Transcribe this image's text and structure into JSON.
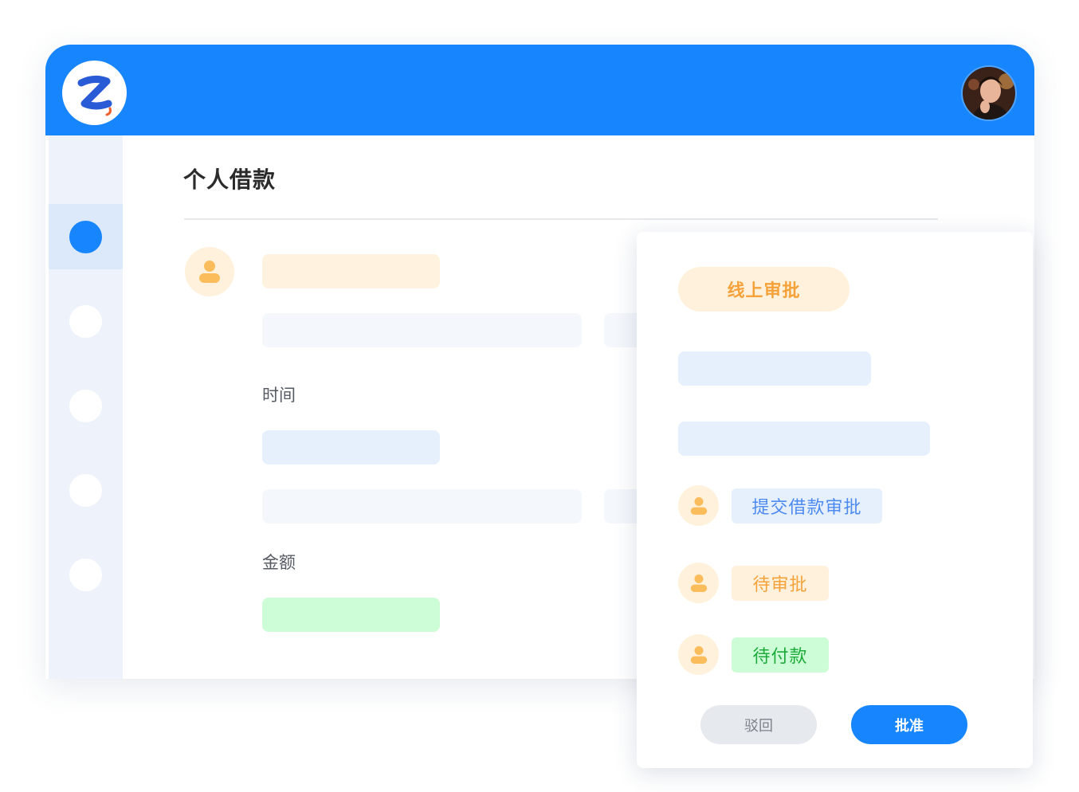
{
  "page": {
    "title": "个人借款"
  },
  "form": {
    "time_label": "时间",
    "amount_label": "金额"
  },
  "approval_card": {
    "status_tag": "线上审批",
    "steps": [
      {
        "icon": "person-icon",
        "label": "提交借款审批",
        "color": "#4d8af0"
      },
      {
        "icon": "person-icon",
        "label": "待审批",
        "color": "#f5a23a"
      },
      {
        "icon": "person-icon",
        "label": "待付款",
        "color": "#1caa3a"
      }
    ],
    "reject_label": "驳回",
    "approve_label": "批准"
  },
  "colors": {
    "brand": "#1685fe",
    "warning": "#f5a23a",
    "success": "#1caa3a"
  }
}
